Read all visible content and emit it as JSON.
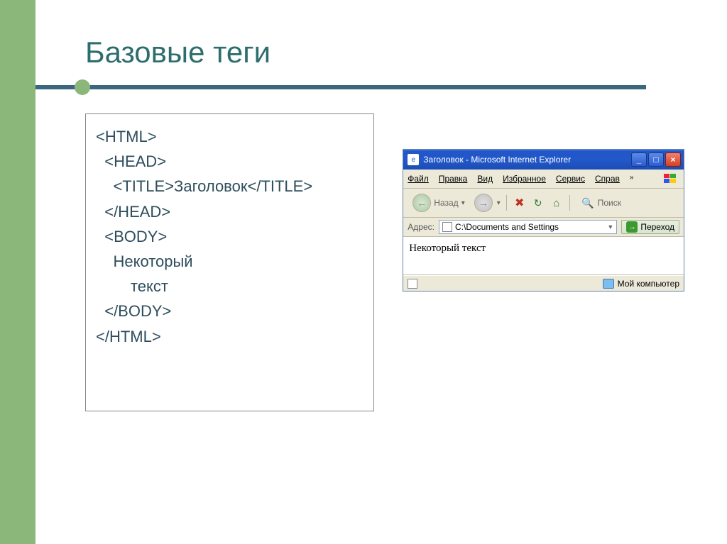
{
  "slide": {
    "title": "Базовые теги"
  },
  "code": {
    "l1": "<HTML>",
    "l2": "  <HEAD>",
    "l3": "    <TITLE>Заголовок</TITLE>",
    "l4": "  </HEAD>",
    "l5": "  <BODY>",
    "l6": "    Некоторый",
    "l7": "        текст",
    "l8": "  </BODY>",
    "l9": "</HTML>"
  },
  "browser": {
    "title": "Заголовок - Microsoft Internet Explorer",
    "menu": {
      "file": "Файл",
      "edit": "Правка",
      "view": "Вид",
      "fav": "Избранное",
      "tools": "Сервис",
      "help": "Справ"
    },
    "toolbar": {
      "back": "Назад",
      "search": "Поиск"
    },
    "address": {
      "label": "Адрес:",
      "value": "C:\\Documents and Settings",
      "go": "Переход"
    },
    "page_text": "Некоторый текст",
    "status": {
      "zone": "Мой компьютер"
    }
  }
}
